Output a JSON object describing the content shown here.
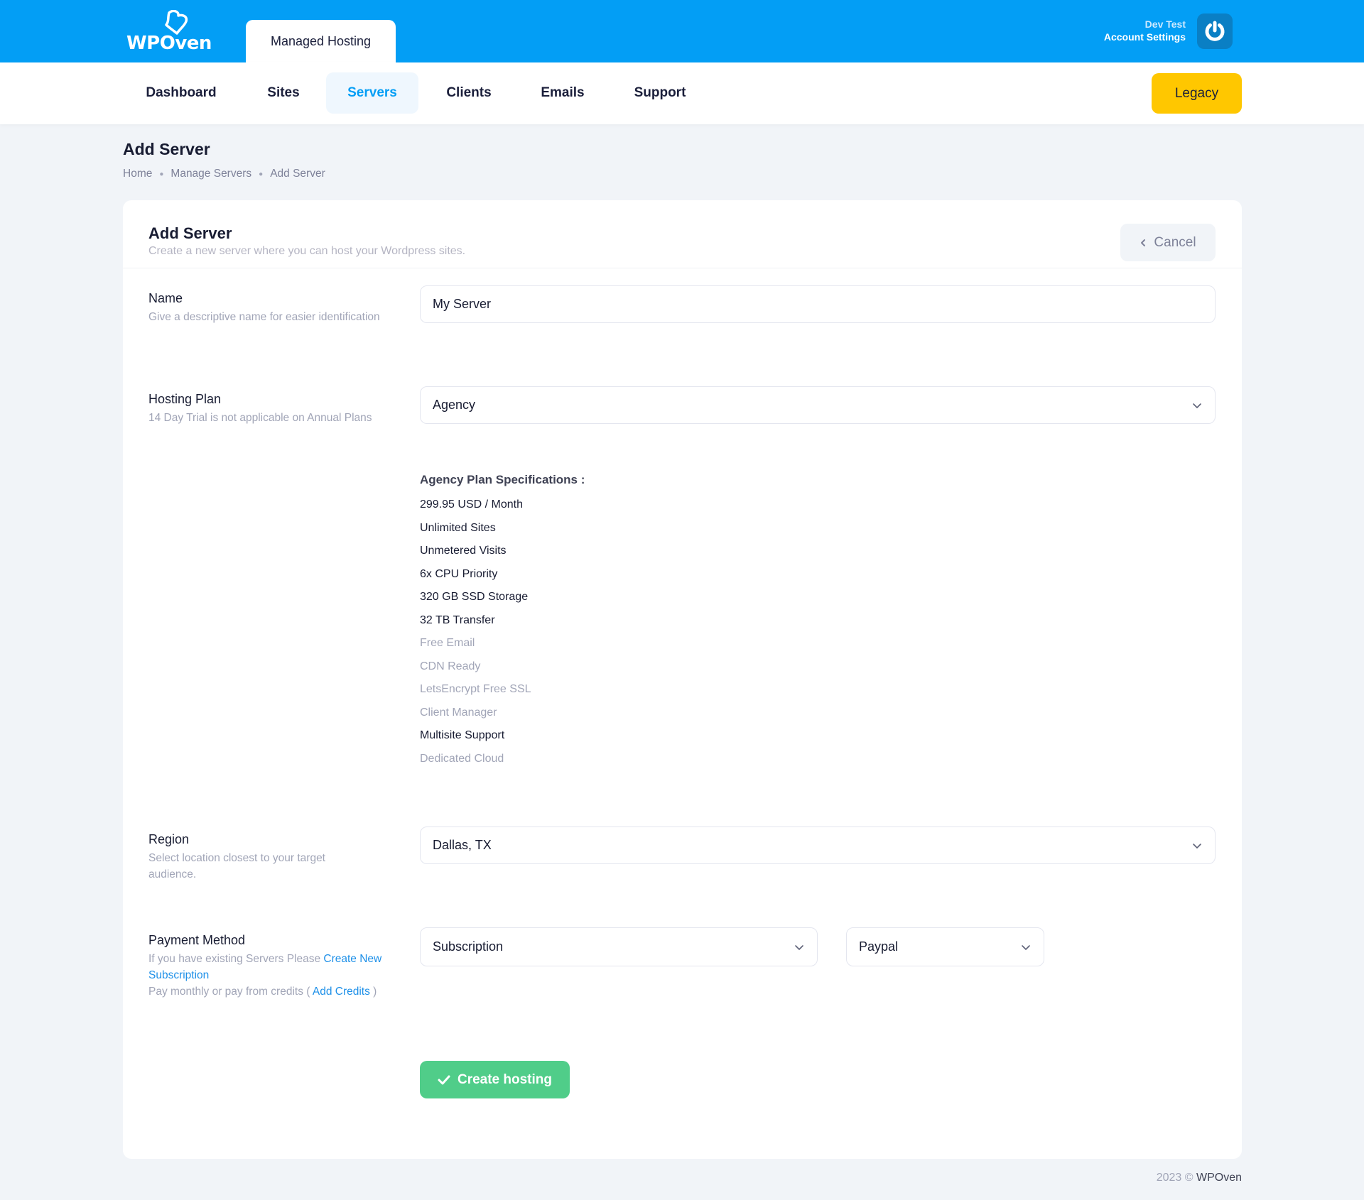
{
  "brand": {
    "logo_text": "WPOven",
    "product_tab": "Managed Hosting",
    "primary_color": "#039ef5",
    "success_color": "#50cd89",
    "warning_color": "#ffc700"
  },
  "account": {
    "user_name": "Dev Test",
    "settings_label": "Account Settings",
    "power_icon": "power-icon"
  },
  "nav": {
    "items": [
      {
        "label": "Dashboard",
        "active": false
      },
      {
        "label": "Sites",
        "active": false
      },
      {
        "label": "Servers",
        "active": true
      },
      {
        "label": "Clients",
        "active": false
      },
      {
        "label": "Emails",
        "active": false
      },
      {
        "label": "Support",
        "active": false
      }
    ],
    "legacy_label": "Legacy"
  },
  "page": {
    "title": "Add Server",
    "breadcrumb": [
      "Home",
      "Manage Servers",
      "Add Server"
    ]
  },
  "card": {
    "title": "Add Server",
    "subtitle": "Create a new server where you can host your Wordpress sites.",
    "cancel_label": "Cancel",
    "cancel_icon": "chevron-left-icon"
  },
  "form": {
    "name": {
      "label": "Name",
      "help": "Give a descriptive name for easier identification",
      "value": "My Server"
    },
    "hosting_plan": {
      "label": "Hosting Plan",
      "help": "14 Day Trial is not applicable on Annual Plans",
      "value": "Agency"
    },
    "plan_specs": {
      "title": "Agency Plan Specifications :",
      "items": [
        {
          "text": "299.95 USD / Month",
          "included": true
        },
        {
          "text": "Unlimited Sites",
          "included": true
        },
        {
          "text": "Unmetered Visits",
          "included": true
        },
        {
          "text": "6x CPU Priority",
          "included": true
        },
        {
          "text": "320 GB SSD Storage",
          "included": true
        },
        {
          "text": "32 TB Transfer",
          "included": true
        },
        {
          "text": "Free Email",
          "included": false
        },
        {
          "text": "CDN Ready",
          "included": false
        },
        {
          "text": "LetsEncrypt Free SSL",
          "included": false
        },
        {
          "text": "Client Manager",
          "included": false
        },
        {
          "text": "Multisite Support",
          "included": true
        },
        {
          "text": "Dedicated Cloud",
          "included": false
        }
      ]
    },
    "region": {
      "label": "Region",
      "help": "Select location closest to your target audience.",
      "value": "Dallas, TX"
    },
    "payment": {
      "label": "Payment Method",
      "help_prefix": "If you have existing Servers Please ",
      "create_subscription_link": "Create New Subscription",
      "help_credits_prefix": "Pay monthly or pay from credits ( ",
      "add_credits_link": "Add Credits",
      "help_credits_suffix": " )",
      "type_value": "Subscription",
      "gateway_value": "Paypal"
    },
    "submit_label": "Create hosting",
    "submit_icon": "check-icon"
  },
  "footer": {
    "year_text": "2023 ©",
    "brand": "WPOven"
  }
}
